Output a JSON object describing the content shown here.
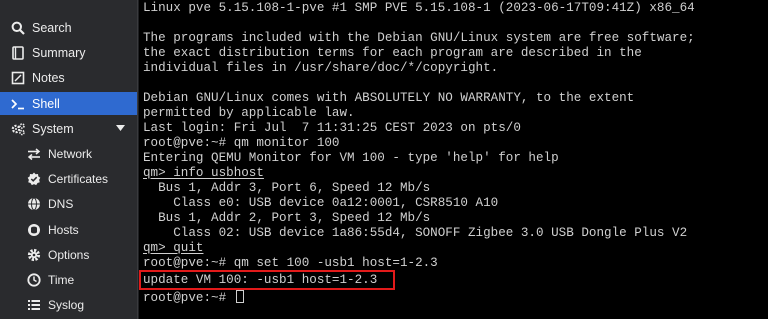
{
  "sidebar": {
    "items": [
      {
        "label": "Search",
        "icon": "search-icon"
      },
      {
        "label": "Summary",
        "icon": "book-icon"
      },
      {
        "label": "Notes",
        "icon": "notes-icon"
      },
      {
        "label": "Shell",
        "icon": "terminal-icon",
        "active": true
      },
      {
        "label": "System",
        "icon": "gears-icon",
        "expanded": true
      },
      {
        "label": "Network",
        "icon": "exchange-icon"
      },
      {
        "label": "Certificates",
        "icon": "certificate-icon"
      },
      {
        "label": "DNS",
        "icon": "globe-icon"
      },
      {
        "label": "Hosts",
        "icon": "database-icon"
      },
      {
        "label": "Options",
        "icon": "gear-icon"
      },
      {
        "label": "Time",
        "icon": "clock-icon"
      },
      {
        "label": "Syslog",
        "icon": "list-icon"
      }
    ]
  },
  "terminal": {
    "lines": [
      "Linux pve 5.15.108-1-pve #1 SMP PVE 5.15.108-1 (2023-06-17T09:41Z) x86_64",
      "",
      "The programs included with the Debian GNU/Linux system are free software;",
      "the exact distribution terms for each program are described in the",
      "individual files in /usr/share/doc/*/copyright.",
      "",
      "Debian GNU/Linux comes with ABSOLUTELY NO WARRANTY, to the extent",
      "permitted by applicable law.",
      "Last login: Fri Jul  7 11:31:25 CEST 2023 on pts/0",
      "root@pve:~# qm monitor 100",
      "Entering QEMU Monitor for VM 100 - type 'help' for help",
      "qm> info usbhost",
      "  Bus 1, Addr 3, Port 6, Speed 12 Mb/s",
      "    Class e0: USB device 0a12:0001, CSR8510 A10",
      "  Bus 1, Addr 2, Port 3, Speed 12 Mb/s",
      "    Class 02: USB device 1a86:55d4, SONOFF Zigbee 3.0 USB Dongle Plus V2",
      "qm> quit",
      "root@pve:~# qm set 100 -usb1 host=1-2.3",
      "update VM 100: -usb1 host=1-2.3",
      "root@pve:~# "
    ]
  },
  "colors": {
    "sidebar_bg": "#2a2b2e",
    "active_bg": "#2f6ad0",
    "terminal_bg": "#000000",
    "terminal_fg": "#d0d0d0",
    "highlight": "#e21a1a"
  }
}
